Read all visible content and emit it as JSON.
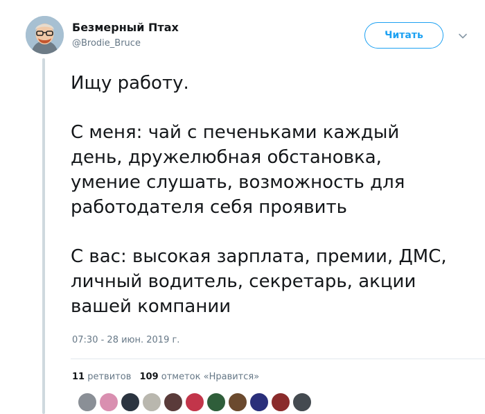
{
  "author": {
    "name": "Безмерный Птах",
    "handle": "@Brodie_Bruce"
  },
  "follow_button_label": "Читать",
  "tweet": {
    "paragraphs": [
      [
        "Ищу работу."
      ],
      [
        "С меня: чай с печеньками каждый",
        "день, дружелюбная обстановка,",
        "умение слушать, возможность для",
        "работодателя себя проявить"
      ],
      [
        "С вас: высокая зарплата, премии, ДМС,",
        "личный водитель, секретарь, акции",
        "вашей компании"
      ]
    ]
  },
  "timestamp": "07:30 - 28 июн. 2019 г.",
  "stats": {
    "retweets_count": "11",
    "retweets_label": "ретвитов",
    "likes_count": "109",
    "likes_label": "отметок «Нравится»"
  },
  "likers": [
    {
      "icon": "avatar-1",
      "color": "#8a8f96"
    },
    {
      "icon": "avatar-2",
      "color": "#d98fb0"
    },
    {
      "icon": "avatar-3",
      "color": "#2b3440"
    },
    {
      "icon": "avatar-4",
      "color": "#b9b7ae"
    },
    {
      "icon": "avatar-5",
      "color": "#5a3b3a"
    },
    {
      "icon": "avatar-6",
      "color": "#c2354a"
    },
    {
      "icon": "avatar-7",
      "color": "#2f5e3a"
    },
    {
      "icon": "avatar-8",
      "color": "#6b4a2e"
    },
    {
      "icon": "avatar-9",
      "color": "#2a2f7a"
    },
    {
      "icon": "avatar-10",
      "color": "#8a2b2b"
    },
    {
      "icon": "avatar-11",
      "color": "#444a50"
    }
  ],
  "colors": {
    "accent": "#1da1f2",
    "text": "#14171a",
    "muted": "#657786"
  }
}
